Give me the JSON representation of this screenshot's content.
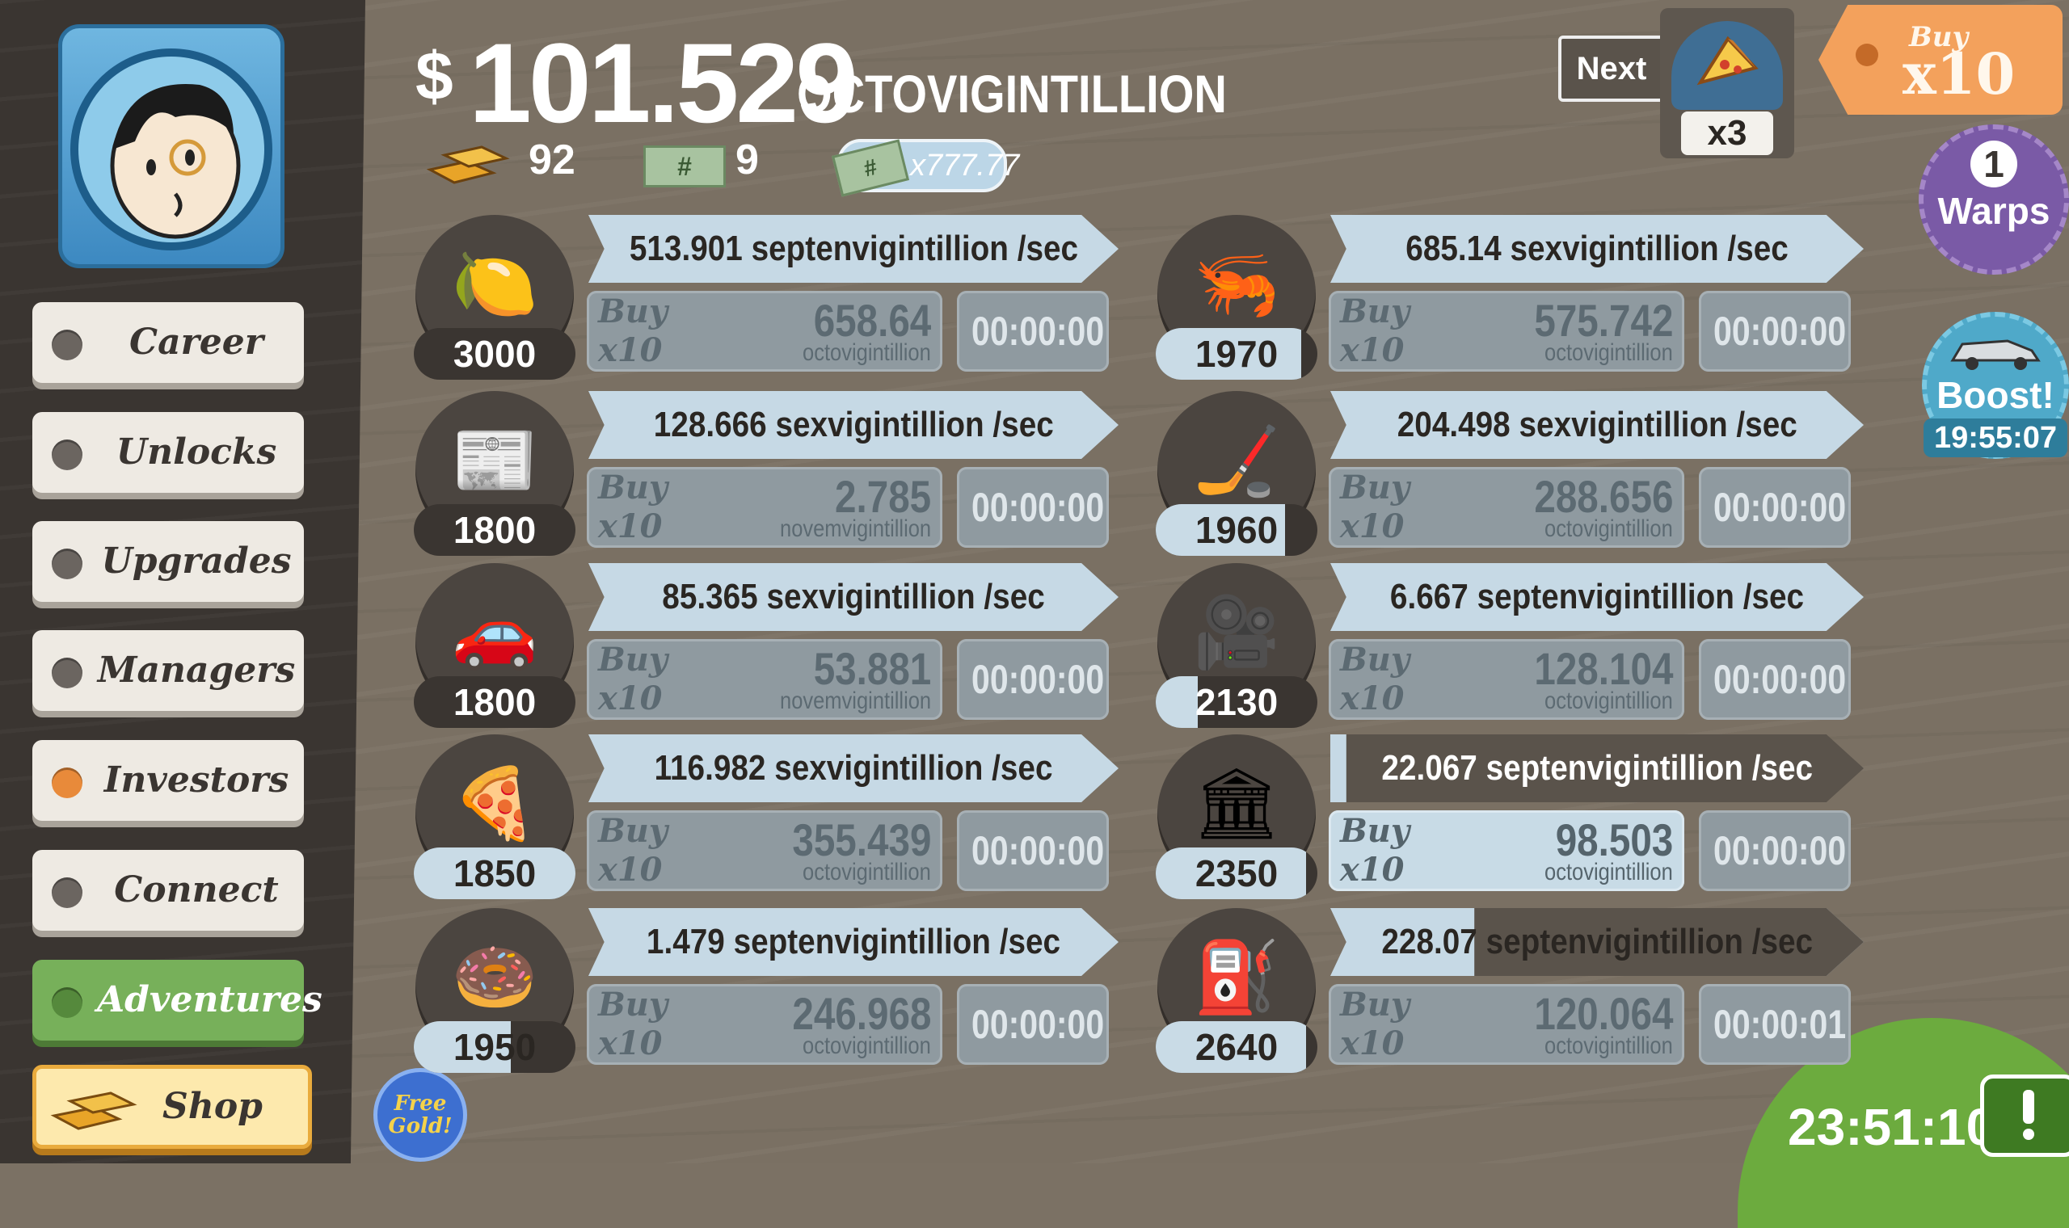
{
  "money": {
    "currency": "$",
    "amount": "101.529",
    "unit": "OCTOVIGINTILLION"
  },
  "stats": {
    "gold": "92",
    "megabucks": "9",
    "multiplier": "x777.77"
  },
  "menu": [
    {
      "label": "Career",
      "state": "default"
    },
    {
      "label": "Unlocks",
      "state": "default"
    },
    {
      "label": "Upgrades",
      "state": "default"
    },
    {
      "label": "Managers",
      "state": "default"
    },
    {
      "label": "Investors",
      "state": "alert"
    },
    {
      "label": "Connect",
      "state": "default"
    },
    {
      "label": "Adventures",
      "state": "active"
    },
    {
      "label": "Shop",
      "state": "shop"
    }
  ],
  "free_gold": "Free Gold!",
  "next": {
    "label": "Next",
    "icon": "pizza-icon",
    "multiplier": "x3"
  },
  "buy_mode": {
    "top": "Buy",
    "value": "x10"
  },
  "warps": {
    "count": "1",
    "label": "Warps"
  },
  "boost": {
    "label": "Boost!",
    "timer": "19:55:07"
  },
  "bottom_timer": "23:51:10",
  "colors": {
    "rate_bar": "#c6d9e5",
    "active_green": "#77b05a",
    "alert_orange": "#e88a3a"
  },
  "businesses": [
    {
      "icon": "lemon-icon",
      "glyph": "🍋",
      "count": "3000",
      "count_progress": 0.0,
      "rate": "513.901 septenvigintillion /sec",
      "buy_a": "Buy",
      "buy_b": "x10",
      "cost": "658.64",
      "cost_unit": "octovigintillion",
      "timer": "00:00:00",
      "affordable": false
    },
    {
      "icon": "newspaper-icon",
      "glyph": "📰",
      "count": "1800",
      "count_progress": 0.0,
      "rate": "128.666 sexvigintillion /sec",
      "buy_a": "Buy",
      "buy_b": "x10",
      "cost": "2.785",
      "cost_unit": "novemvigintillion",
      "timer": "00:00:00",
      "affordable": false
    },
    {
      "icon": "car-wash-icon",
      "glyph": "🚗",
      "count": "1800",
      "count_progress": 0.0,
      "rate": "85.365 sexvigintillion /sec",
      "buy_a": "Buy",
      "buy_b": "x10",
      "cost": "53.881",
      "cost_unit": "novemvigintillion",
      "timer": "00:00:00",
      "affordable": false
    },
    {
      "icon": "pizza-icon",
      "glyph": "🍕",
      "count": "1850",
      "count_progress": 1.0,
      "rate": "116.982 sexvigintillion /sec",
      "buy_a": "Buy",
      "buy_b": "x10",
      "cost": "355.439",
      "cost_unit": "octovigintillion",
      "timer": "00:00:00",
      "affordable": false
    },
    {
      "icon": "donut-icon",
      "glyph": "🍩",
      "count": "1950",
      "count_progress": 0.6,
      "rate": "1.479 septenvigintillion /sec",
      "buy_a": "Buy",
      "buy_b": "x10",
      "cost": "246.968",
      "cost_unit": "octovigintillion",
      "timer": "00:00:00",
      "affordable": false
    },
    {
      "icon": "shrimp-icon",
      "glyph": "🦐",
      "count": "1970",
      "count_progress": 0.9,
      "rate": "685.14 sexvigintillion /sec",
      "buy_a": "Buy",
      "buy_b": "x10",
      "cost": "575.742",
      "cost_unit": "octovigintillion",
      "timer": "00:00:00",
      "affordable": false
    },
    {
      "icon": "hockey-icon",
      "glyph": "🏒",
      "count": "1960",
      "count_progress": 0.8,
      "rate": "204.498 sexvigintillion /sec",
      "buy_a": "Buy",
      "buy_b": "x10",
      "cost": "288.656",
      "cost_unit": "octovigintillion",
      "timer": "00:00:00",
      "affordable": false
    },
    {
      "icon": "movie-camera-icon",
      "glyph": "🎥",
      "count": "2130",
      "count_progress": 0.26,
      "rate": "6.667 septenvigintillion /sec",
      "buy_a": "Buy",
      "buy_b": "x10",
      "cost": "128.104",
      "cost_unit": "octovigintillion",
      "timer": "00:00:00",
      "affordable": false
    },
    {
      "icon": "bank-icon",
      "glyph": "🏛",
      "count": "2350",
      "count_progress": 0.93,
      "rate": "22.067 septenvigintillion /sec",
      "buy_a": "Buy",
      "buy_b": "x10",
      "cost": "98.503",
      "cost_unit": "octovigintillion",
      "timer": "00:00:00",
      "affordable": true
    },
    {
      "icon": "oil-rig-icon",
      "glyph": "⛽",
      "count": "2640",
      "count_progress": 0.93,
      "rate": "228.07 septenvigintillion /sec",
      "buy_a": "Buy",
      "buy_b": "x10",
      "cost": "120.064",
      "cost_unit": "octovigintillion",
      "timer": "00:00:01",
      "affordable": false,
      "rate_progress": 0.27
    }
  ]
}
